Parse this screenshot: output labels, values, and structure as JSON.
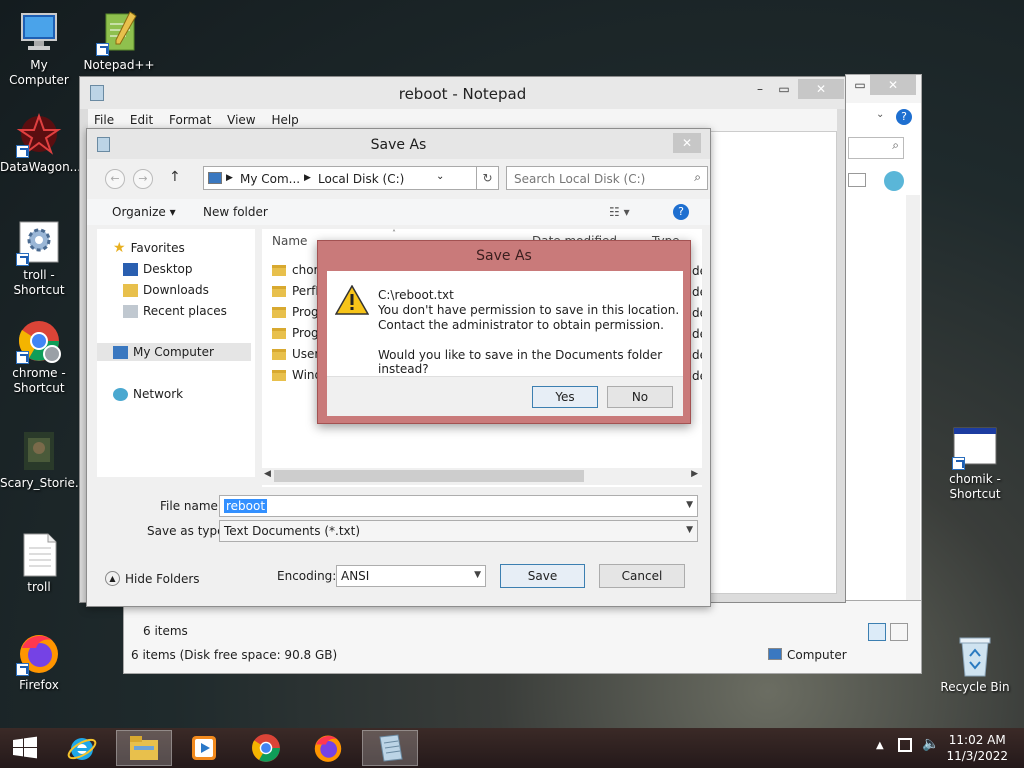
{
  "desktop": {
    "icons": [
      {
        "label": "My Computer"
      },
      {
        "label": "Notepad++"
      },
      {
        "label": "DataWagon..."
      },
      {
        "label": "troll - Shortcut"
      },
      {
        "label": "chrome - Shortcut"
      },
      {
        "label": "Scary_Storie..."
      },
      {
        "label": "troll"
      },
      {
        "label": "Firefox"
      },
      {
        "label": "chomik - Shortcut"
      },
      {
        "label": "Recycle Bin"
      }
    ]
  },
  "explorer_bg": {
    "status_items": "6 items",
    "status_bar": "6 items (Disk free space: 90.8 GB)",
    "location": "Computer"
  },
  "notepad": {
    "title": "reboot - Notepad",
    "menu": [
      "File",
      "Edit",
      "Format",
      "View",
      "Help"
    ]
  },
  "saveas": {
    "title": "Save As",
    "breadcrumb": [
      "My Com...",
      "Local Disk (C:)"
    ],
    "search_placeholder": "Search Local Disk (C:)",
    "organize": "Organize",
    "new_folder": "New folder",
    "nav": {
      "favorites": "Favorites",
      "desktop": "Desktop",
      "downloads": "Downloads",
      "recent": "Recent places",
      "my_computer": "My Computer",
      "network": "Network"
    },
    "columns": {
      "name": "Name",
      "date": "Date modified",
      "type": "Type"
    },
    "files": [
      "chor",
      "PerfL",
      "Prog",
      "Prog",
      "Users",
      "Wind"
    ],
    "file_type_partial": "der",
    "file_name_label": "File name:",
    "file_name_value": "reboot",
    "save_type_label": "Save as type:",
    "save_type_value": "Text Documents (*.txt)",
    "hide_folders": "Hide Folders",
    "encoding_label": "Encoding:",
    "encoding_value": "ANSI",
    "save": "Save",
    "cancel": "Cancel"
  },
  "msgbox": {
    "title": "Save As",
    "path": "C:\\reboot.txt",
    "line1": "You don't have permission to save in this location.",
    "line2": "Contact the administrator to obtain permission.",
    "question": "Would you like to save in the Documents folder instead?",
    "yes": "Yes",
    "no": "No"
  },
  "taskbar": {
    "time": "11:02 AM",
    "date": "11/3/2022"
  },
  "colors": {
    "msgbox_frame": "#c97a7a",
    "accent_blue": "#3c7fb1",
    "taskbar": "#2e2120"
  }
}
